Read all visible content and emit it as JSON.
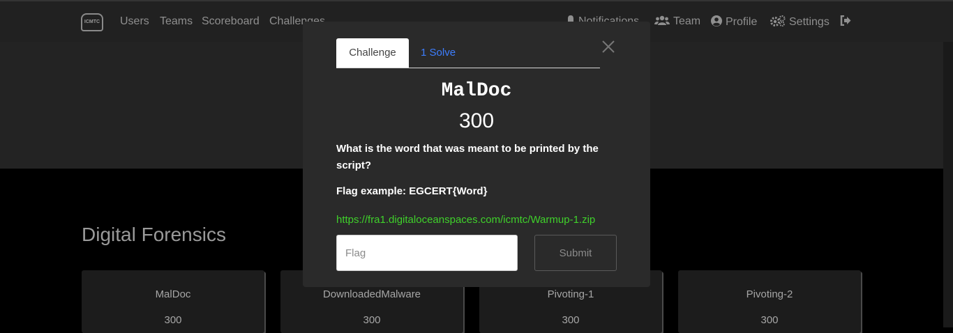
{
  "navbar": {
    "logo_text": "ICMTC",
    "links": [
      "Users",
      "Teams",
      "Scoreboard",
      "Challenges"
    ],
    "right": {
      "notifications": "Notifications",
      "team": "Team",
      "profile": "Profile",
      "settings": "Settings"
    }
  },
  "page": {
    "category_title": "Digital Forensics",
    "cards": [
      {
        "name": "MalDoc",
        "value": "300"
      },
      {
        "name": "DownloadedMalware",
        "value": "300"
      },
      {
        "name": "Pivoting-1",
        "value": "300"
      },
      {
        "name": "Pivoting-2",
        "value": "300"
      }
    ]
  },
  "modal": {
    "tab_challenge": "Challenge",
    "tab_solves": "1 Solve",
    "name": "MalDoc",
    "value": "300",
    "description": "What is the word that was meant to be printed by the script?",
    "flag_example": "Flag example: EGCERT{Word}",
    "file_link": "https://fra1.digitaloceanspaces.com/icmtc/Warmup-1.zip",
    "flag_placeholder": "Flag",
    "submit_label": "Submit"
  },
  "colors": {
    "accent_link": "#3d7eff",
    "file_link": "#3fd12a",
    "modal_bg": "#2a2a2a"
  },
  "icons": [
    "bell-icon",
    "users-icon",
    "user-circle-icon",
    "cogs-icon",
    "logout-icon",
    "close-icon"
  ]
}
